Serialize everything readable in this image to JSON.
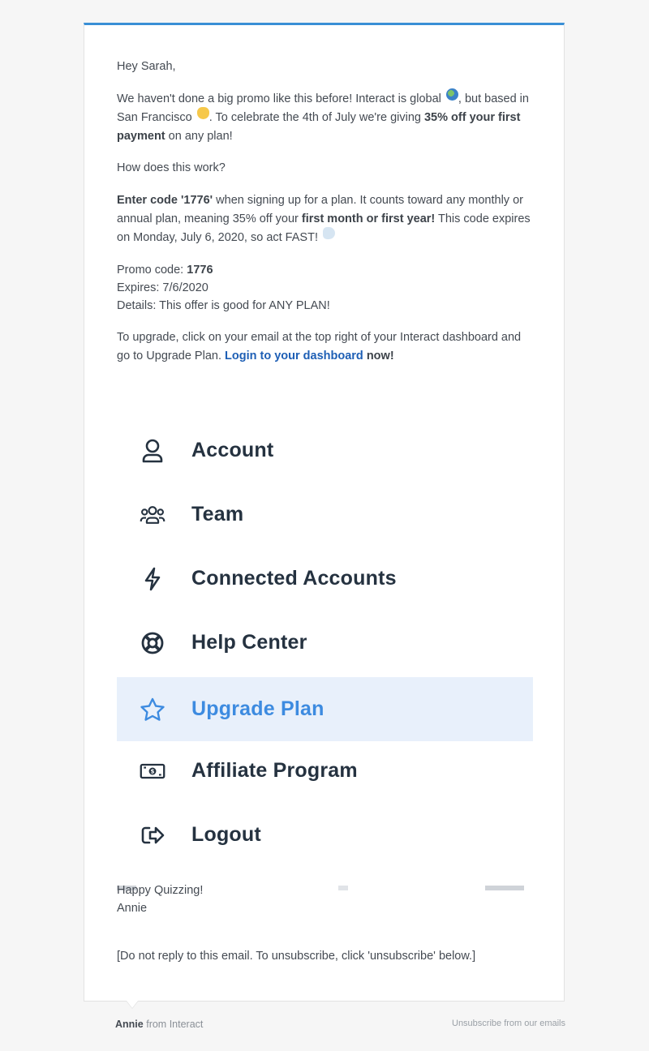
{
  "email": {
    "greeting": "Hey Sarah,",
    "p1": {
      "t1": "We haven't done a big promo like this before! Interact is global",
      "t2": ", but based in San Francisco",
      "t3": ".  To celebrate the 4th of July we're giving",
      "bold1": "35% off your first payment",
      "t4": "on any plan!"
    },
    "p2": "How does this work?",
    "p3": {
      "bold1": "Enter code '1776'",
      "t1": "when signing up for a plan. It counts toward any monthly or annual plan, meaning 35% off your",
      "bold2": "first month or first year!",
      "t2": "This code expires on Monday, July 6, 2020, so act FAST!"
    },
    "promo": {
      "code_label": "Promo code:",
      "code": "1776",
      "expires": "Expires: 7/6/2020",
      "details": "Details: This offer is good for ANY PLAN!"
    },
    "p5": {
      "t1": "To upgrade, click on your email at the top right of your Interact dashboard and go to Upgrade Plan.",
      "link": "Login to your dashboard",
      "t2": "now!"
    },
    "signoff1": "Happy Quizzing!",
    "signoff2": "Annie",
    "disclaimer": "[Do not reply to this email. To unsubscribe, click 'unsubscribe' below.]"
  },
  "menu": {
    "items": [
      {
        "label": "Account",
        "icon": "user-icon"
      },
      {
        "label": "Team",
        "icon": "team-icon"
      },
      {
        "label": "Connected Accounts",
        "icon": "bolt-icon"
      },
      {
        "label": "Help Center",
        "icon": "lifebuoy-icon"
      },
      {
        "label": "Upgrade Plan",
        "icon": "star-icon",
        "active": true
      },
      {
        "label": "Affiliate Program",
        "icon": "money-icon"
      },
      {
        "label": "Logout",
        "icon": "logout-icon"
      }
    ],
    "colors": {
      "text": "#253240",
      "active_text": "#3d8be0",
      "active_bg": "#e8f0fb"
    }
  },
  "footer": {
    "sender": "Annie",
    "from_text": "from Interact",
    "unsubscribe": "Unsubscribe from our emails"
  },
  "colors": {
    "accent": "#3a8fd6",
    "link": "#1e5fb5"
  }
}
